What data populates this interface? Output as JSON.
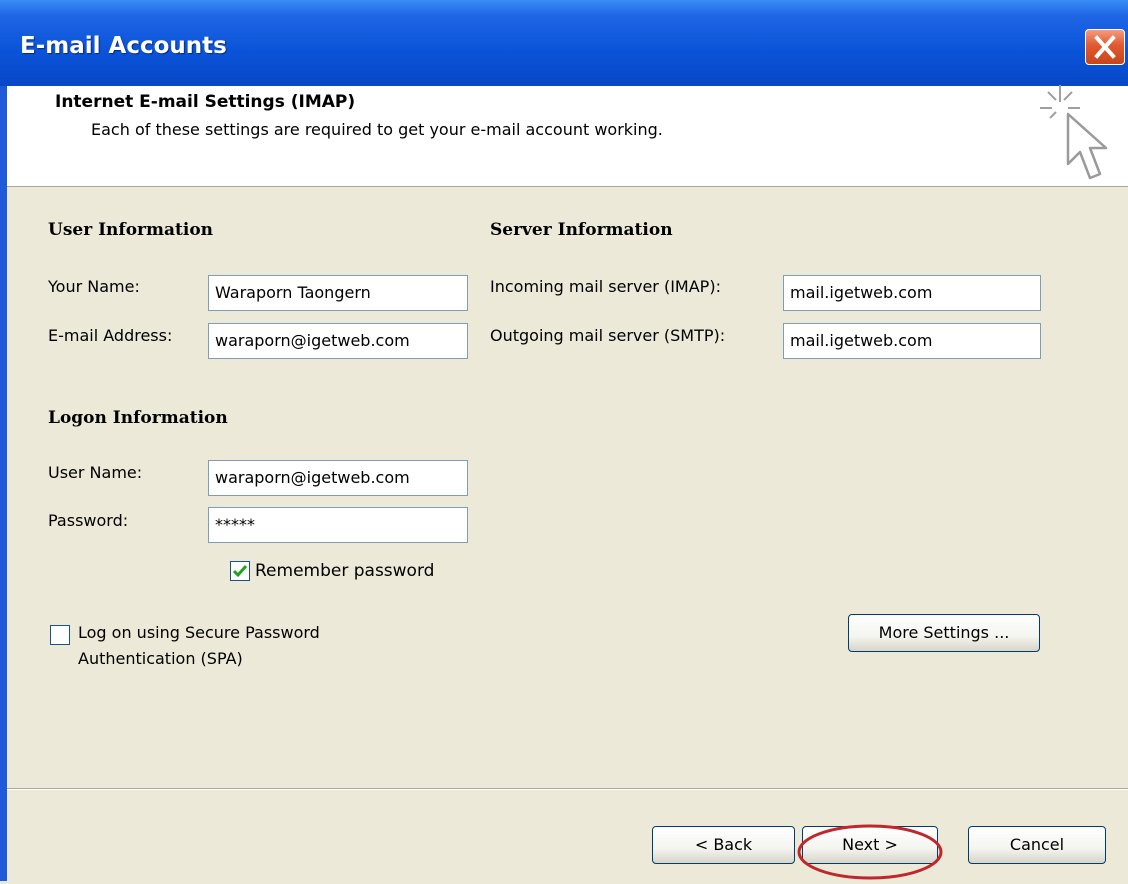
{
  "window": {
    "title": "E-mail Accounts",
    "close_icon": "close-icon"
  },
  "header": {
    "title": "Internet E-mail Settings (IMAP)",
    "subtitle": "Each of these settings are required to get your e-mail account working.",
    "icon": "cursor-sparkle-icon"
  },
  "user_info": {
    "heading": "User Information",
    "name_label": "Your Name:",
    "name_value": "Waraporn Taongern",
    "email_label": "E-mail Address:",
    "email_value": "waraporn@igetweb.com"
  },
  "server_info": {
    "heading": "Server Information",
    "incoming_label": "Incoming mail server (IMAP):",
    "incoming_value": "mail.igetweb.com",
    "outgoing_label": "Outgoing mail server (SMTP):",
    "outgoing_value": "mail.igetweb.com"
  },
  "logon_info": {
    "heading": "Logon Information",
    "username_label": "User Name:",
    "username_value": "waraporn@igetweb.com",
    "password_label": "Password:",
    "password_value": "*****",
    "remember_label": "Remember password",
    "remember_checked": true,
    "spa_label_line1": "Log on using Secure Password",
    "spa_label_line2": "Authentication (SPA)",
    "spa_checked": false
  },
  "buttons": {
    "more_settings": "More Settings ...",
    "back": "< Back",
    "next": "Next >",
    "cancel": "Cancel"
  },
  "colors": {
    "title_bar": "#0a53d8",
    "dialog_bg": "#ece9d8",
    "highlight_ring": "#c0272d",
    "check_mark": "#21a121"
  }
}
